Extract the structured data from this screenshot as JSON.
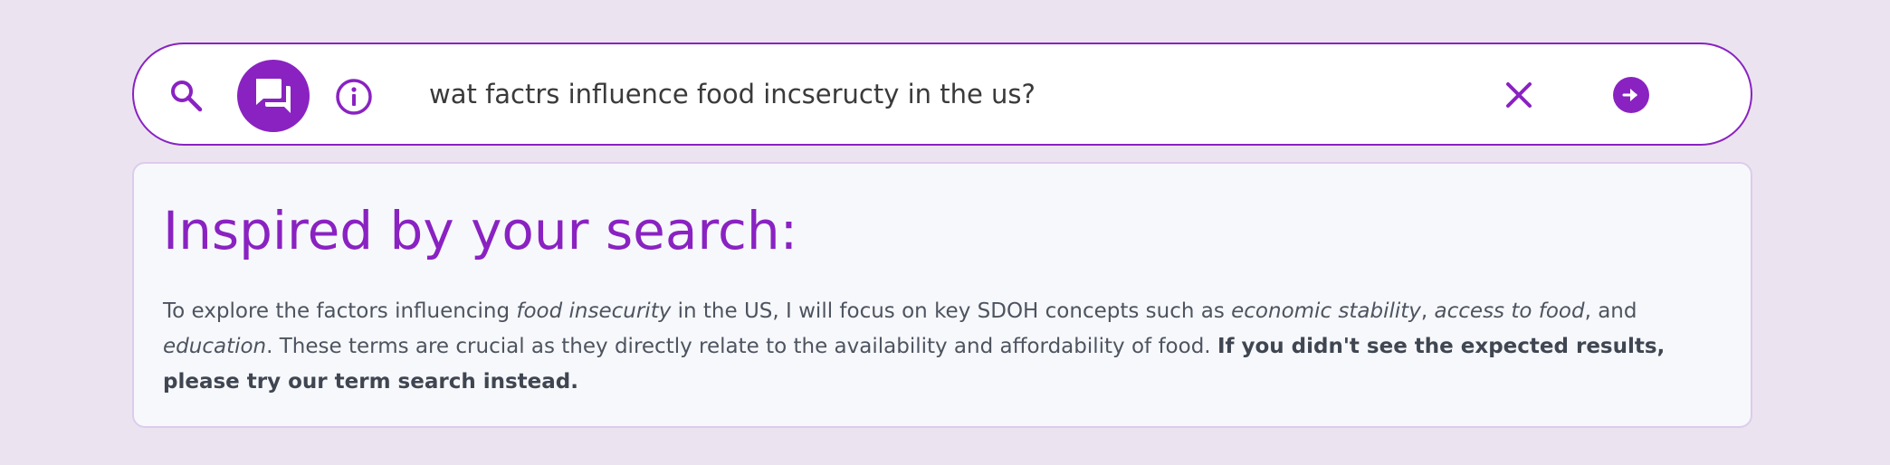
{
  "search": {
    "query": "wat factrs influence food incseructy in the us?"
  },
  "icons": {
    "search": "search-icon",
    "chat_mode": "chat-bubbles-icon",
    "info": "info-icon",
    "clear": "close-icon",
    "submit": "arrow-right-circle-icon"
  },
  "colors": {
    "accent": "#8a22c2",
    "page_background": "#ebe4f0",
    "card_background": "#f7f8fb",
    "body_text": "#4d5460"
  },
  "result": {
    "title": "Inspired by your search:",
    "text_1": "To explore the factors influencing ",
    "term_1": "food insecurity",
    "text_2": " in the US, I will focus on key SDOH concepts such as ",
    "term_2": "economic stability",
    "text_3": ", ",
    "term_3": "access to food",
    "text_4": ", and ",
    "term_4": "education",
    "text_5": ". These terms are crucial as they directly relate to the availability and affordability of food. ",
    "fallback_notice": "If you didn't see the expected results, please try our term search instead."
  }
}
